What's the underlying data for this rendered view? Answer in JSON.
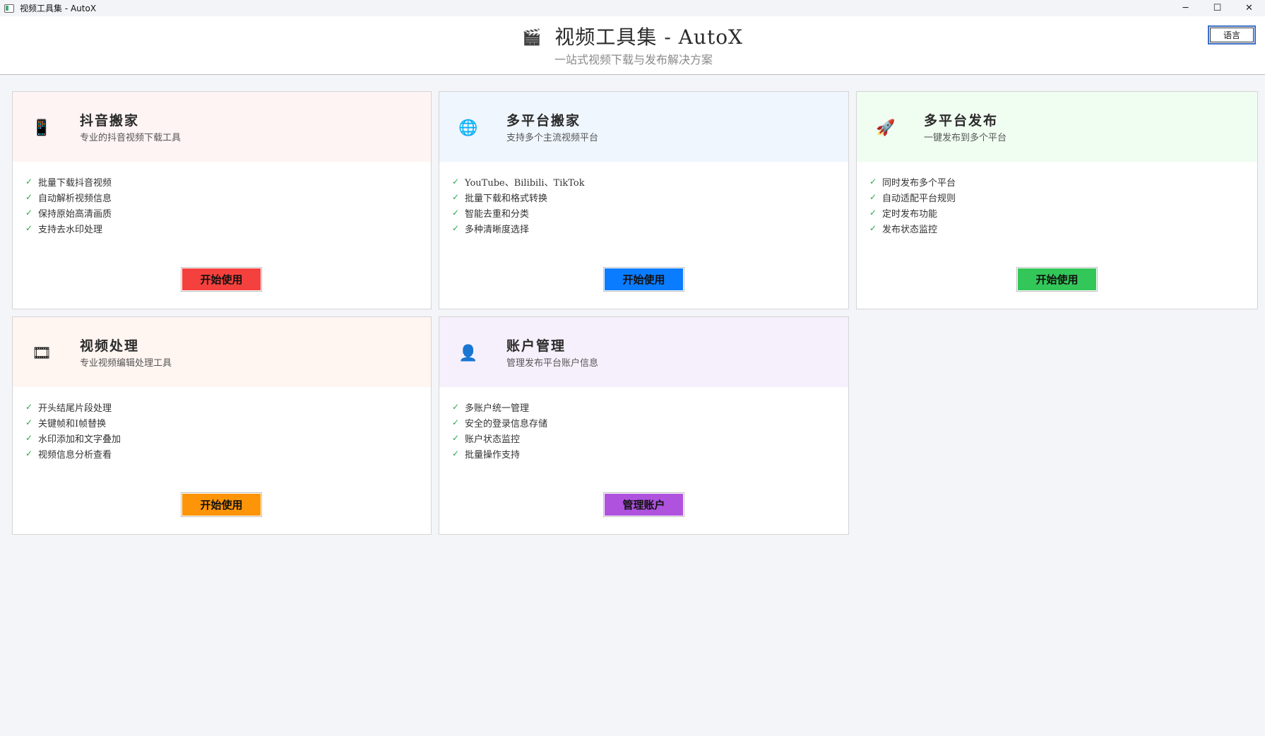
{
  "window": {
    "title": "视频工具集 - AutoX",
    "controls": [
      "─",
      "☐",
      "✕"
    ]
  },
  "header": {
    "title": "视频工具集 - AutoX",
    "subtitle": "一站式视频下载与发布解决方案",
    "language_button": "语言"
  },
  "cards": [
    {
      "icon": "phone-icon",
      "icon_glyph": "📱",
      "title": "抖音搬家",
      "description": "专业的抖音视频下载工具",
      "features": [
        "批量下载抖音视频",
        "自动解析视频信息",
        "保持原始高清画质",
        "支持去水印处理"
      ],
      "button": "开始使用",
      "head_color": "#fff4f4",
      "button_color": "#f5413d"
    },
    {
      "icon": "globe-icon",
      "icon_glyph": "🌐",
      "title": "多平台搬家",
      "description": "支持多个主流视频平台",
      "features": [
        "YouTube、Bilibili、TikTok",
        "批量下载和格式转换",
        "智能去重和分类",
        "多种清晰度选择"
      ],
      "button": "开始使用",
      "head_color": "#eff6fe",
      "button_color": "#0a7cff"
    },
    {
      "icon": "rocket-icon",
      "icon_glyph": "🚀",
      "title": "多平台发布",
      "description": "一键发布到多个平台",
      "features": [
        "同时发布多个平台",
        "自动适配平台规则",
        "定时发布功能",
        "发布状态监控"
      ],
      "button": "开始使用",
      "head_color": "#f0fdf1",
      "button_color": "#33c759"
    },
    {
      "icon": "film-icon",
      "icon_glyph": "🎞",
      "title": "视频处理",
      "description": "专业视频编辑处理工具",
      "features": [
        "开头结尾片段处理",
        "关键帧和I帧替换",
        "水印添加和文字叠加",
        "视频信息分析查看"
      ],
      "button": "开始使用",
      "head_color": "#fff5f1",
      "button_color": "#fe9508"
    },
    {
      "icon": "user-icon",
      "icon_glyph": "👤",
      "title": "账户管理",
      "description": "管理发布平台账户信息",
      "features": [
        "多账户统一管理",
        "安全的登录信息存储",
        "账户状态监控",
        "批量操作支持"
      ],
      "button": "管理账户",
      "head_color": "#f6f0fc",
      "button_color": "#af52de"
    }
  ]
}
